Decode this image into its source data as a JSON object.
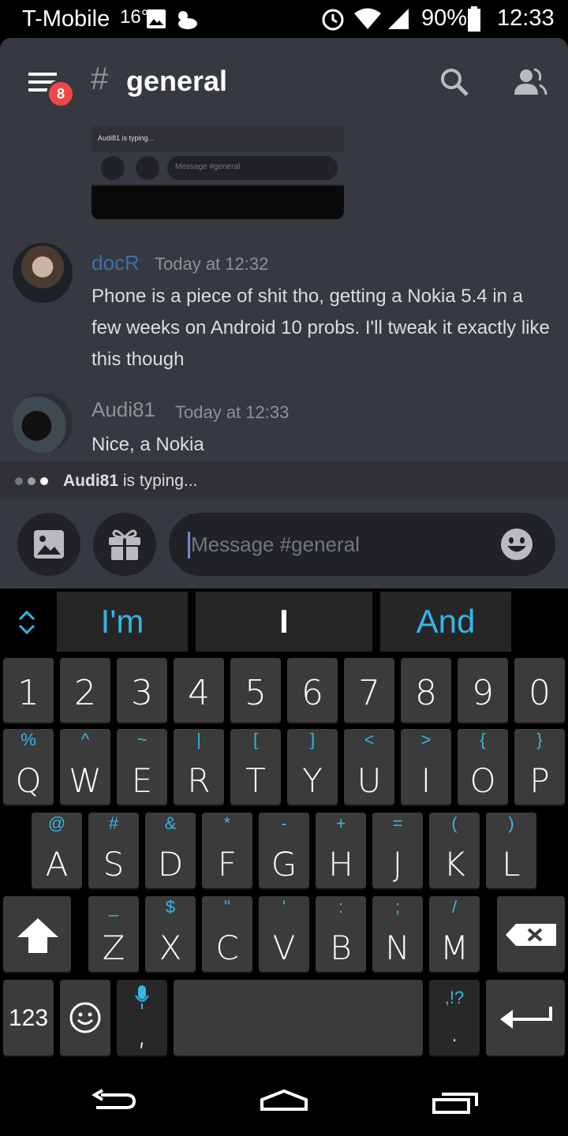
{
  "status_bar": {
    "carrier": "T-Mobile",
    "temperature": "16°",
    "battery": "90%",
    "time": "12:33"
  },
  "header": {
    "notification_count": "8",
    "hash": "#",
    "channel": "general"
  },
  "preview": {
    "typing_text": "Audi81 is typing...",
    "placeholder": "Message #general"
  },
  "messages": [
    {
      "user": "docR",
      "user_color": "#3e6fa8",
      "time": "Today at 12:32",
      "text": "Phone is a piece of shit tho, getting a Nokia 5.4 in a few weeks on Android 10 probs. I'll tweak it exactly like this though"
    },
    {
      "user": "Audi81",
      "user_color": "#8e9297",
      "time": "Today at 12:33",
      "text": "Nice, a Nokia"
    }
  ],
  "typing": {
    "user": "Audi81",
    "suffix": " is typing..."
  },
  "composer": {
    "placeholder": "Message #general"
  },
  "keyboard": {
    "suggestions": [
      "I'm",
      "I",
      "And"
    ],
    "number_row": [
      "1",
      "2",
      "3",
      "4",
      "5",
      "6",
      "7",
      "8",
      "9",
      "0"
    ],
    "row1": [
      {
        "main": "Q",
        "sub": "%"
      },
      {
        "main": "W",
        "sub": "^"
      },
      {
        "main": "E",
        "sub": "~"
      },
      {
        "main": "R",
        "sub": "|"
      },
      {
        "main": "T",
        "sub": "["
      },
      {
        "main": "Y",
        "sub": "]"
      },
      {
        "main": "U",
        "sub": "<"
      },
      {
        "main": "I",
        "sub": ">"
      },
      {
        "main": "O",
        "sub": "{"
      },
      {
        "main": "P",
        "sub": "}"
      }
    ],
    "row2": [
      {
        "main": "A",
        "sub": "@"
      },
      {
        "main": "S",
        "sub": "#"
      },
      {
        "main": "D",
        "sub": "&"
      },
      {
        "main": "F",
        "sub": "*"
      },
      {
        "main": "G",
        "sub": "-"
      },
      {
        "main": "H",
        "sub": "+"
      },
      {
        "main": "J",
        "sub": "="
      },
      {
        "main": "K",
        "sub": "("
      },
      {
        "main": "L",
        "sub": ")"
      }
    ],
    "row3": [
      {
        "main": "Z",
        "sub": "_"
      },
      {
        "main": "X",
        "sub": "$"
      },
      {
        "main": "C",
        "sub": "\""
      },
      {
        "main": "V",
        "sub": "'"
      },
      {
        "main": "B",
        "sub": ":"
      },
      {
        "main": "N",
        "sub": ";"
      },
      {
        "main": "M",
        "sub": "/"
      }
    ],
    "numbers_label": "123",
    "comma": ",",
    "period": ".",
    "period_alt": ",!?"
  },
  "colors": {
    "accent": "#34b5e5",
    "discord_bg": "#36393f",
    "badge": "#f04747"
  }
}
